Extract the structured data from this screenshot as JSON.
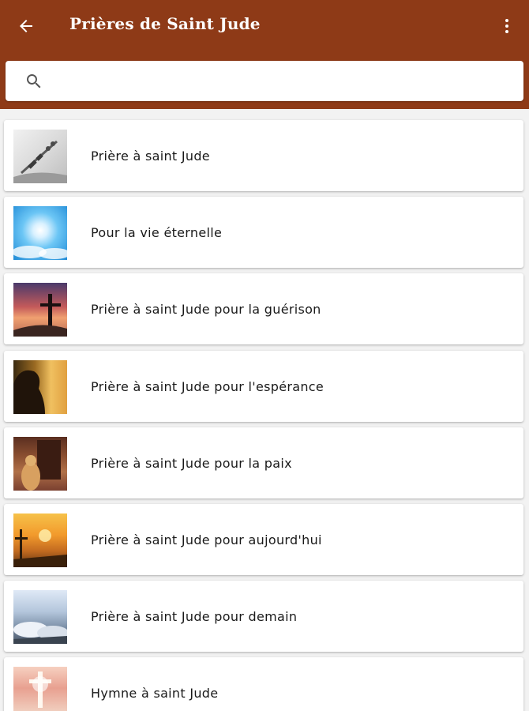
{
  "app_bar": {
    "title": "Prières de Saint Jude",
    "background": "#8e3a17",
    "back_icon": "arrow-back-icon",
    "menu_icon": "more-vert-icon"
  },
  "search": {
    "value": "",
    "placeholder": "",
    "icon": "search-icon"
  },
  "list": {
    "items": [
      {
        "label": "Prière à saint Jude"
      },
      {
        "label": "Pour la vie éternelle"
      },
      {
        "label": "Prière à saint Jude pour la guérison"
      },
      {
        "label": "Prière à saint Jude pour l'espérance"
      },
      {
        "label": "Prière à saint Jude pour la paix"
      },
      {
        "label": "Prière à saint Jude pour aujourd'hui"
      },
      {
        "label": "Prière à saint Jude pour demain"
      },
      {
        "label": "Hymne à saint Jude"
      }
    ]
  }
}
